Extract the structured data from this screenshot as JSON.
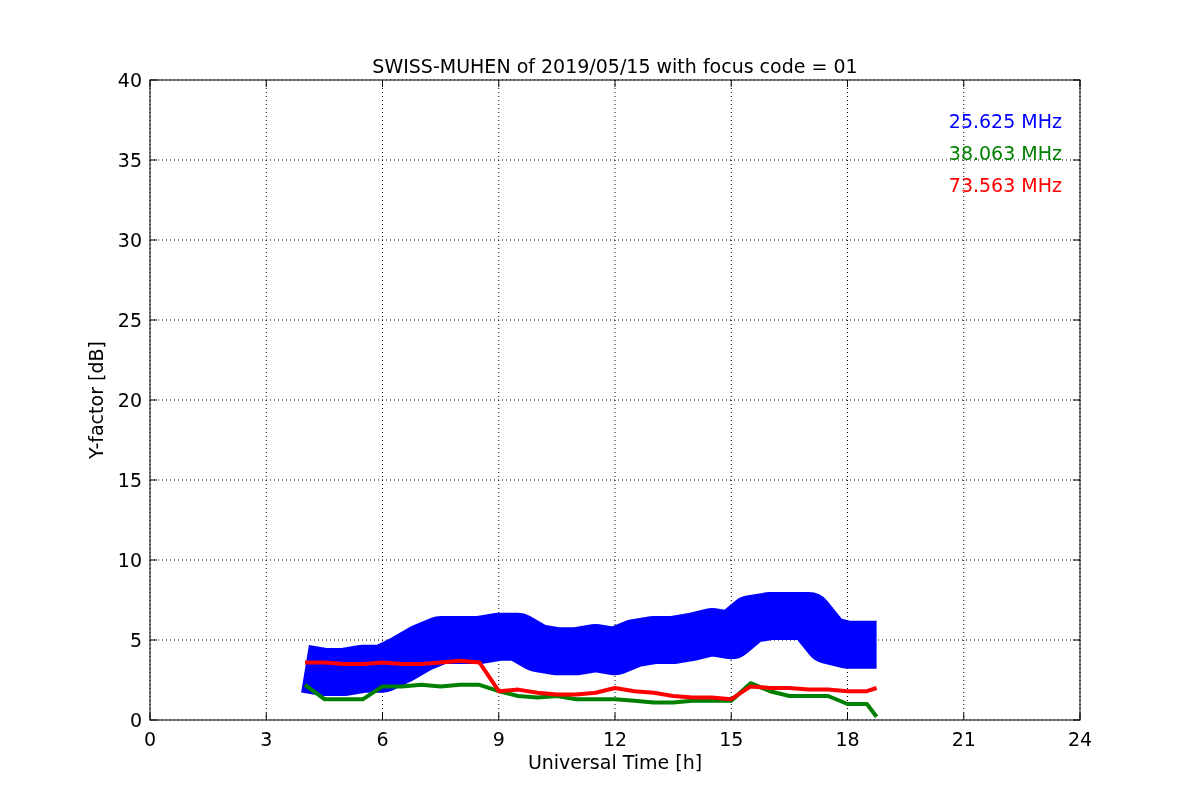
{
  "chart_data": {
    "type": "line",
    "title": "SWISS-MUHEN of 2019/05/15 with focus code = 01",
    "xlabel": "Universal Time [h]",
    "ylabel": "Y-factor [dB]",
    "x": [
      4,
      4.5,
      5,
      5.5,
      6,
      6.5,
      7,
      7.5,
      8,
      8.5,
      9,
      9.5,
      10,
      10.5,
      11,
      11.5,
      12,
      12.5,
      13,
      13.5,
      14,
      14.5,
      15,
      15.5,
      16,
      16.5,
      17,
      17.5,
      18,
      18.5,
      18.75
    ],
    "series": [
      {
        "name": "25.625 MHz",
        "color": "#0000ff",
        "values": [
          3.2,
          3.0,
          3.0,
          3.2,
          3.2,
          3.8,
          4.5,
          5.0,
          5.0,
          5.0,
          5.2,
          5.2,
          4.5,
          4.3,
          4.3,
          4.5,
          4.3,
          4.8,
          5.0,
          5.0,
          5.2,
          5.5,
          5.3,
          6.3,
          6.5,
          6.5,
          6.5,
          5.0,
          4.7,
          4.7,
          4.7
        ]
      },
      {
        "name": "38.063 MHz",
        "color": "#008000",
        "values": [
          2.2,
          1.3,
          1.3,
          1.3,
          2.1,
          2.1,
          2.2,
          2.1,
          2.2,
          2.2,
          1.8,
          1.5,
          1.4,
          1.5,
          1.3,
          1.3,
          1.3,
          1.2,
          1.1,
          1.1,
          1.2,
          1.2,
          1.2,
          2.3,
          1.8,
          1.5,
          1.5,
          1.5,
          1.0,
          1.0,
          0.2
        ]
      },
      {
        "name": "73.563 MHz",
        "color": "#ff0000",
        "values": [
          3.6,
          3.6,
          3.5,
          3.5,
          3.6,
          3.5,
          3.5,
          3.6,
          3.7,
          3.6,
          1.8,
          1.9,
          1.7,
          1.6,
          1.6,
          1.7,
          2.0,
          1.8,
          1.7,
          1.5,
          1.4,
          1.4,
          1.3,
          2.1,
          2.0,
          2.0,
          1.9,
          1.9,
          1.8,
          1.8,
          2.0
        ]
      }
    ],
    "xlim": [
      0,
      24
    ],
    "ylim": [
      0,
      40
    ],
    "xticks": [
      0,
      3,
      6,
      9,
      12,
      15,
      18,
      21,
      24
    ],
    "yticks": [
      0,
      5,
      10,
      15,
      20,
      25,
      30,
      35,
      40
    ],
    "grid": true
  }
}
